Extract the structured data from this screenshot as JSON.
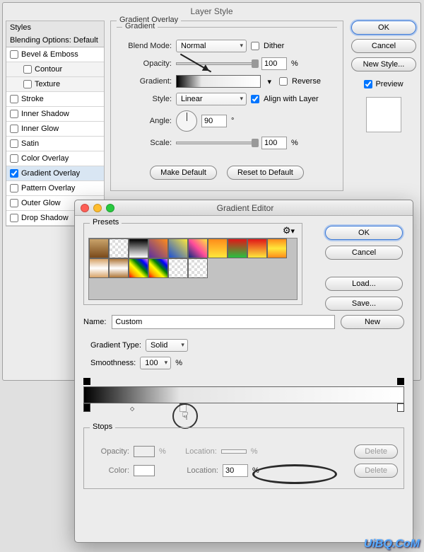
{
  "layerStyle": {
    "title": "Layer Style",
    "stylesHeader": "Styles",
    "blendingOptions": "Blending Options: Default",
    "items": [
      {
        "label": "Bevel & Emboss",
        "checked": false
      },
      {
        "label": "Contour",
        "checked": false,
        "sub": true
      },
      {
        "label": "Texture",
        "checked": false,
        "sub": true
      },
      {
        "label": "Stroke",
        "checked": false
      },
      {
        "label": "Inner Shadow",
        "checked": false
      },
      {
        "label": "Inner Glow",
        "checked": false
      },
      {
        "label": "Satin",
        "checked": false
      },
      {
        "label": "Color Overlay",
        "checked": false
      },
      {
        "label": "Gradient Overlay",
        "checked": true,
        "hl": true
      },
      {
        "label": "Pattern Overlay",
        "checked": false
      },
      {
        "label": "Outer Glow",
        "checked": false
      },
      {
        "label": "Drop Shadow",
        "checked": false
      }
    ],
    "overlay": {
      "groupTitle": "Gradient Overlay",
      "subTitle": "Gradient",
      "blendModeLabel": "Blend Mode:",
      "blendModeValue": "Normal",
      "ditherLabel": "Dither",
      "opacityLabel": "Opacity:",
      "opacityValue": "100",
      "pct": "%",
      "gradientLabel": "Gradient:",
      "reverseLabel": "Reverse",
      "styleLabel": "Style:",
      "styleValue": "Linear",
      "alignLabel": "Align with Layer",
      "angleLabel": "Angle:",
      "angleValue": "90",
      "deg": "°",
      "scaleLabel": "Scale:",
      "scaleValue": "100",
      "makeDefault": "Make Default",
      "resetDefault": "Reset to Default"
    },
    "side": {
      "ok": "OK",
      "cancel": "Cancel",
      "newStyle": "New Style...",
      "preview": "Preview"
    }
  },
  "gradientEditor": {
    "title": "Gradient Editor",
    "presetsLabel": "Presets",
    "side": {
      "ok": "OK",
      "cancel": "Cancel",
      "load": "Load...",
      "save": "Save..."
    },
    "nameLabel": "Name:",
    "nameValue": "Custom",
    "new": "New",
    "typeLabel": "Gradient Type:",
    "typeValue": "Solid",
    "smoothLabel": "Smoothness:",
    "smoothValue": "100",
    "pct": "%",
    "stops": {
      "title": "Stops",
      "opacityLabel": "Opacity:",
      "opacityLocationLabel": "Location:",
      "colorLabel": "Color:",
      "locationLabel": "Location:",
      "locationValue": "30",
      "delete": "Delete"
    }
  },
  "watermark": "UiBQ.CoM"
}
